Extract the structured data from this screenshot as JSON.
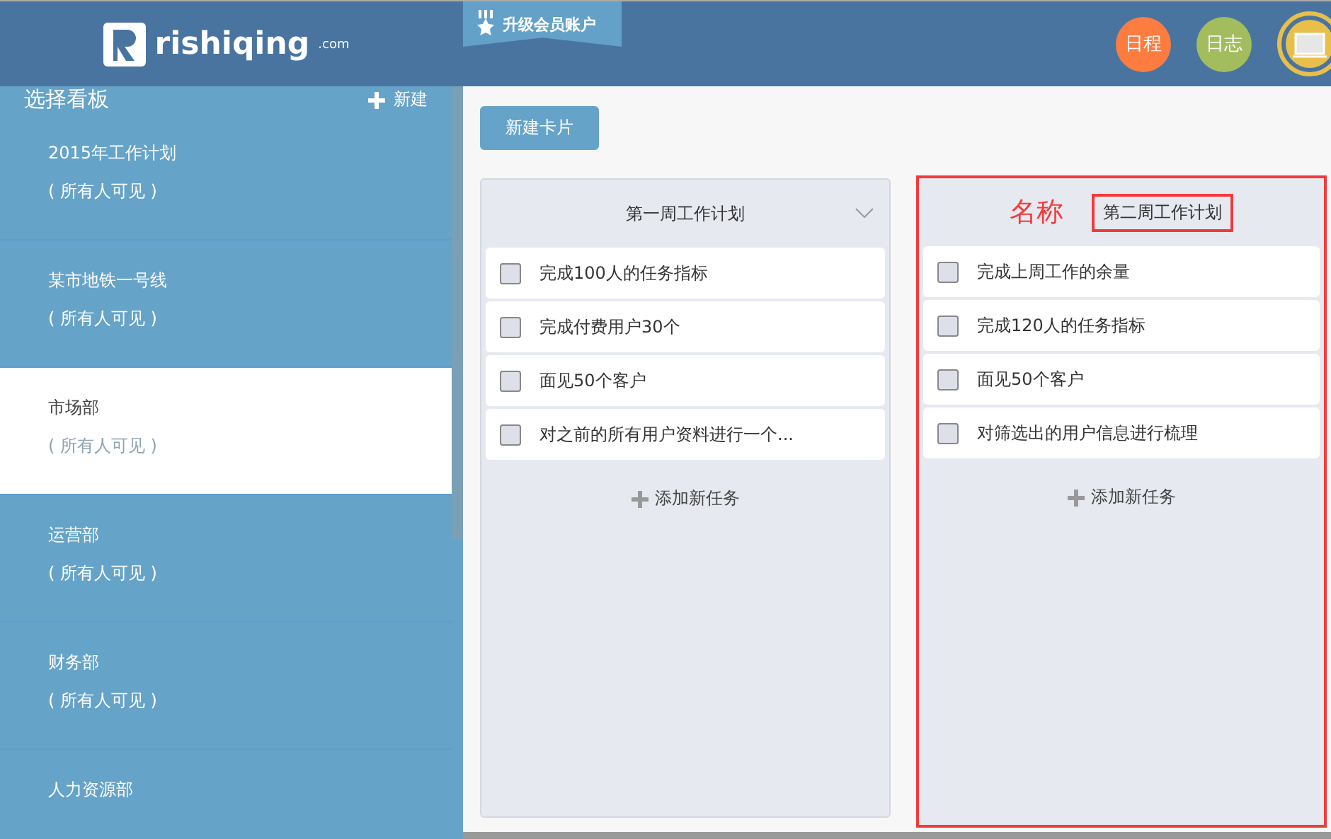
{
  "header": {
    "logo_text": "rishiqing",
    "logo_suffix": ".com",
    "upgrade_badge": "升级会员账户",
    "buttons": [
      {
        "label": "日程",
        "color": "#fd7c3f"
      },
      {
        "label": "日志",
        "color": "#a3bc5e"
      }
    ]
  },
  "sidebar": {
    "title": "选择看板",
    "new_button": "新建",
    "boards": [
      {
        "name": "2015年工作计划",
        "visibility": "( 所有人可见 )",
        "selected": false
      },
      {
        "name": "某市地铁一号线",
        "visibility": "( 所有人可见 )",
        "selected": false
      },
      {
        "name": "市场部",
        "visibility": "( 所有人可见 )",
        "selected": true
      },
      {
        "name": "运营部",
        "visibility": "( 所有人可见 )",
        "selected": false
      },
      {
        "name": "财务部",
        "visibility": "( 所有人可见 )",
        "selected": false
      },
      {
        "name": "人力资源部",
        "selected": false
      }
    ]
  },
  "main": {
    "new_card_button": "新建卡片",
    "lists": [
      {
        "title": "第一周工作计划",
        "dropdown": true,
        "highlighted": false,
        "tasks": [
          {
            "text": "完成100人的任务指标",
            "checked": false
          },
          {
            "text": "完成付费用户30个",
            "checked": false
          },
          {
            "text": "面见50个客户",
            "checked": false
          },
          {
            "text": "对之前的所有用户资料进行一个...",
            "checked": false
          }
        ],
        "add_task": "添加新任务"
      },
      {
        "title": "第二周工作计划",
        "dropdown": false,
        "highlighted": true,
        "annotation": "名称",
        "tasks": [
          {
            "text": "完成上周工作的余量",
            "checked": false
          },
          {
            "text": "完成120人的任务指标",
            "checked": false
          },
          {
            "text": "面见50个客户",
            "checked": false
          },
          {
            "text": "对筛选出的用户信息进行梳理",
            "checked": false
          }
        ],
        "add_task": "添加新任务"
      }
    ]
  }
}
